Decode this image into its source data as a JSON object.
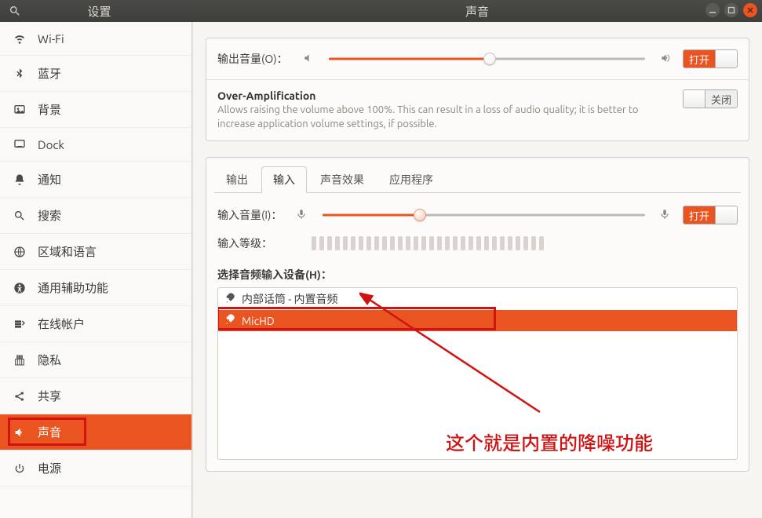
{
  "titlebar": {
    "left_title": "设置",
    "right_title": "声音"
  },
  "sidebar": {
    "items": [
      {
        "icon": "wifi",
        "label": "Wi-Fi"
      },
      {
        "icon": "bluetooth",
        "label": "蓝牙"
      },
      {
        "icon": "background",
        "label": "背景"
      },
      {
        "icon": "dock",
        "label": "Dock"
      },
      {
        "icon": "bell",
        "label": "通知"
      },
      {
        "icon": "search",
        "label": "搜索"
      },
      {
        "icon": "globe",
        "label": "区域和语言"
      },
      {
        "icon": "a11y",
        "label": "通用辅助功能"
      },
      {
        "icon": "accounts",
        "label": "在线帐户"
      },
      {
        "icon": "privacy",
        "label": "隐私"
      },
      {
        "icon": "share",
        "label": "共享"
      },
      {
        "icon": "sound",
        "label": "声音",
        "active": true
      },
      {
        "icon": "power",
        "label": "电源"
      }
    ]
  },
  "output": {
    "label": "输出音量(O)：",
    "slider_percent": 51,
    "toggle_label": "打开",
    "toggle_on": true
  },
  "overamp": {
    "title": "Over-Amplification",
    "desc": "Allows raising the volume above 100%. This can result in a loss of audio quality; it is better to increase application volume settings, if possible.",
    "toggle_label": "关闭",
    "toggle_on": false
  },
  "tabs": {
    "items": [
      {
        "id": "output",
        "label": "输出"
      },
      {
        "id": "input",
        "label": "输入",
        "active": true
      },
      {
        "id": "effects",
        "label": "声音效果"
      },
      {
        "id": "apps",
        "label": "应用程序"
      }
    ]
  },
  "input": {
    "volume_label": "输入音量(I)：",
    "slider_percent": 30,
    "toggle_label": "打开",
    "toggle_on": true,
    "level_label": "输入等级：",
    "level_bar_count": 30,
    "device_section_label": "选择音频输入设备(H)：",
    "devices": [
      {
        "label": "内部话筒 - 内置音频",
        "selected": false
      },
      {
        "label": "MicHD",
        "selected": true,
        "highlight_box": true
      }
    ]
  },
  "annotation": {
    "text": "这个就是内置的降噪功能"
  }
}
